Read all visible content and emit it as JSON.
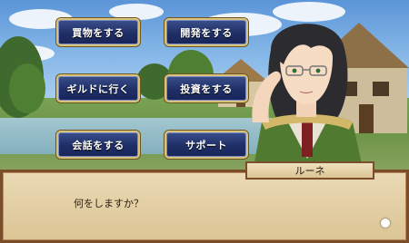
{
  "menu": {
    "buttons": [
      {
        "label": "買物をする"
      },
      {
        "label": "開発をする"
      },
      {
        "label": "ギルドに行く"
      },
      {
        "label": "投資をする"
      },
      {
        "label": "会話をする"
      },
      {
        "label": "サポート"
      }
    ]
  },
  "dialog": {
    "speaker": "ルーネ",
    "text": "何をしますか？"
  },
  "colors": {
    "button_bg": "#1f2f66",
    "button_border": "#d9c27a",
    "dialog_bg": "#e4d2a8",
    "dialog_border": "#7a4e2a"
  }
}
